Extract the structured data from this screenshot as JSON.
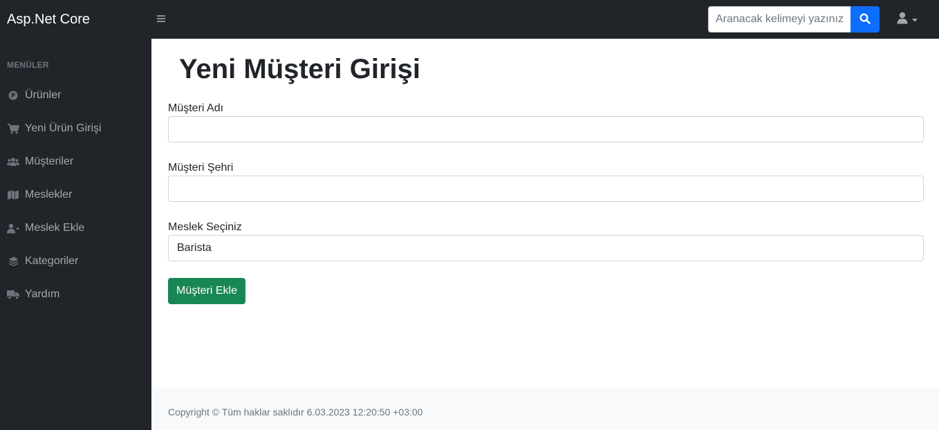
{
  "navbar": {
    "brand": "Asp.Net Core",
    "search_placeholder": "Aranacak kelimeyi yazınız...",
    "search_icon": "search-icon",
    "user_icon": "user-icon"
  },
  "sidebar": {
    "heading": "MENÜLER",
    "items": [
      {
        "label": "Ürünler",
        "icon": "product-icon"
      },
      {
        "label": "Yeni Ürün Girişi",
        "icon": "cart-icon"
      },
      {
        "label": "Müşteriler",
        "icon": "users-icon"
      },
      {
        "label": "Meslekler",
        "icon": "map-icon"
      },
      {
        "label": "Meslek Ekle",
        "icon": "user-plus-icon"
      },
      {
        "label": "Kategoriler",
        "icon": "layers-icon"
      },
      {
        "label": "Yardım",
        "icon": "truck-icon"
      }
    ]
  },
  "form": {
    "title": "Yeni Müşteri Girişi",
    "name_label": "Müşteri Adı",
    "name_value": "",
    "city_label": "Müşteri Şehri",
    "city_value": "",
    "job_label": "Meslek Seçiniz",
    "job_selected": "Barista",
    "submit_label": "Müşteri Ekle"
  },
  "footer": {
    "copyright": "Copyright © Tüm haklar saklıdır 6.03.2023 12:20:50 +03:00"
  },
  "colors": {
    "dark_bg": "#212529",
    "primary": "#0d6efd",
    "success": "#198754",
    "footer_bg": "#f8f9fa"
  }
}
